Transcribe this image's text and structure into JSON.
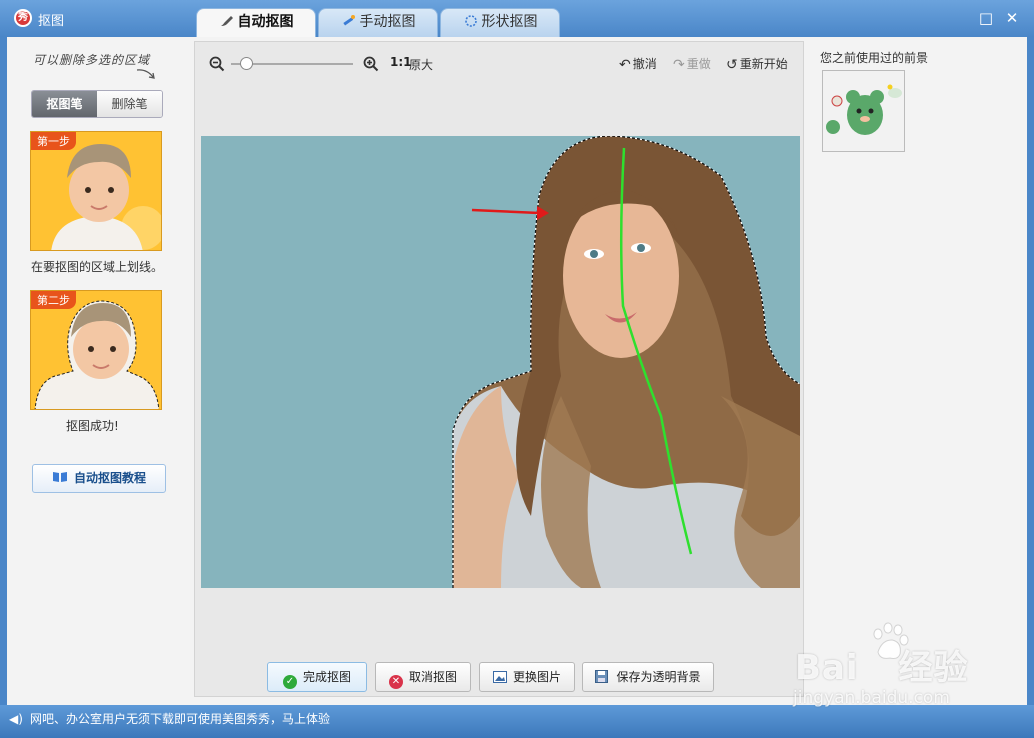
{
  "window": {
    "title": "抠图",
    "logo_text": "秀",
    "maximize_glyph": "□",
    "close_glyph": "✕"
  },
  "tabs": [
    {
      "label": "自动抠图",
      "icon": "brush-icon",
      "active": true
    },
    {
      "label": "手动抠图",
      "icon": "magic-wand-icon",
      "active": false
    },
    {
      "label": "形状抠图",
      "icon": "shape-icon",
      "active": false
    }
  ],
  "left_panel": {
    "hint": "可以删除多选的区域",
    "tools": [
      {
        "label": "抠图笔",
        "active": true
      },
      {
        "label": "删除笔",
        "active": false
      }
    ],
    "steps": [
      {
        "badge": "第一步",
        "caption": "在要抠图的区域上划线。"
      },
      {
        "badge": "第二步",
        "caption": "抠图成功!"
      }
    ],
    "tutorial_label": "自动抠图教程"
  },
  "toolbar": {
    "ratio_label": "1:1",
    "original_label": "原大",
    "undo_label": "撤消",
    "redo_label": "重做",
    "restart_label": "重新开始",
    "zoom_level": 0.12
  },
  "bottom_buttons": {
    "finish": "完成抠图",
    "cancel": "取消抠图",
    "replace": "更换图片",
    "save": "保存为透明背景"
  },
  "right_panel": {
    "prev_label": "您之前使用过的前景"
  },
  "status": {
    "text": "网吧、办公室用户无须下载即可使用美图秀秀，马上体验"
  },
  "watermark": {
    "brand": "Bai",
    "brand_cn": "经验",
    "url": "jingyan.baidu.com"
  },
  "colors": {
    "accent": "#4a86c8",
    "canvas_bg": "#86b4bd",
    "stroke_green": "#2ee02e",
    "arrow_red": "#e01a1a",
    "step_bg": "#ffc233"
  }
}
